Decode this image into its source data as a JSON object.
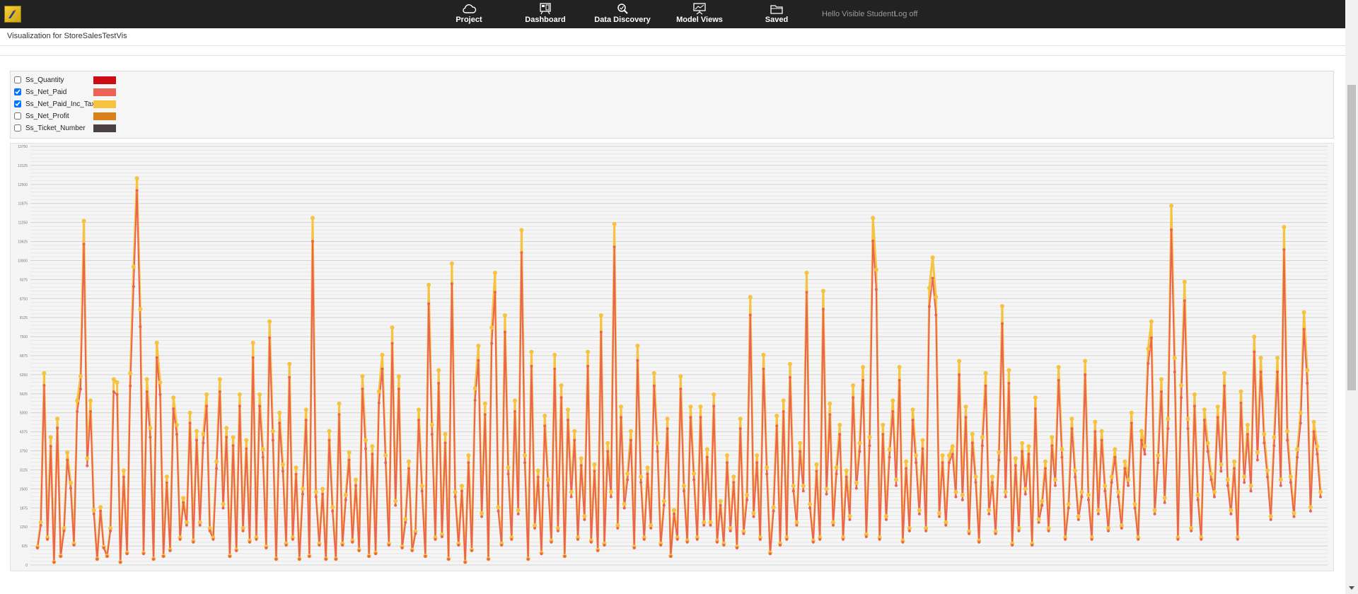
{
  "nav": {
    "items": [
      {
        "label": "Project",
        "icon": "cloud-icon"
      },
      {
        "label": "Dashboard",
        "icon": "dashboard-icon"
      },
      {
        "label": "Data Discovery",
        "icon": "magnifier-icon"
      },
      {
        "label": "Model Views",
        "icon": "presentation-icon"
      },
      {
        "label": "Saved",
        "icon": "folder-icon"
      }
    ],
    "greeting": "Hello Visible Student!",
    "logoff": "Log off"
  },
  "page": {
    "title": "Visualization for StoreSalesTestVis"
  },
  "legend": {
    "items": [
      {
        "label": "Ss_Quantity",
        "checked": false,
        "color": "#cc0b12"
      },
      {
        "label": "Ss_Net_Paid",
        "checked": true,
        "color": "#ea6354"
      },
      {
        "label": "Ss_Net_Paid_Inc_Tax",
        "checked": true,
        "color": "#f6c33e"
      },
      {
        "label": "Ss_Net_Profit",
        "checked": false,
        "color": "#d9801a"
      },
      {
        "label": "Ss_Ticket_Number",
        "checked": false,
        "color": "#4a4146"
      }
    ]
  },
  "chart_data": {
    "type": "line",
    "ylim": [
      0,
      13750
    ],
    "yticks": [
      "0",
      "625",
      "1250",
      "1875",
      "2500",
      "3125",
      "3750",
      "4375",
      "5000",
      "5625",
      "6250",
      "6875",
      "7500",
      "8125",
      "8750",
      "9375",
      "10000",
      "10625",
      "11250",
      "11875",
      "12500",
      "13125",
      "13750"
    ],
    "grid": true,
    "series": [
      {
        "name": "Ss_Net_Paid_Inc_Tax",
        "color": "#f6c33e",
        "values": [
          600,
          1400,
          6300,
          900,
          4200,
          100,
          4800,
          300,
          1200,
          3700,
          2700,
          700,
          5400,
          6200,
          11300,
          3500,
          5400,
          1800,
          200,
          1900,
          600,
          300,
          1200,
          6100,
          6000,
          100,
          3100,
          400,
          6300,
          9800,
          12700,
          8400,
          400,
          6100,
          4500,
          200,
          7300,
          6000,
          300,
          2900,
          500,
          5500,
          4600,
          900,
          2200,
          1400,
          5000,
          800,
          4400,
          1400,
          4300,
          5600,
          1200,
          900,
          3400,
          6100,
          2000,
          4500,
          300,
          4200,
          500,
          5600,
          1200,
          4100,
          800,
          7300,
          900,
          5600,
          3800,
          600,
          8000,
          4400,
          200,
          5000,
          3300,
          700,
          6600,
          900,
          3200,
          200,
          2500,
          5100,
          300,
          11400,
          2400,
          700,
          2500,
          200,
          4400,
          1900,
          200,
          5300,
          700,
          2300,
          3700,
          800,
          2800,
          500,
          6200,
          4100,
          300,
          3900,
          400,
          5700,
          6900,
          3600,
          700,
          7800,
          2100,
          6200,
          600,
          1500,
          3400,
          500,
          1100,
          5100,
          2600,
          300,
          9200,
          4600,
          900,
          6400,
          1000,
          4300,
          200,
          9900,
          2400,
          700,
          2600,
          100,
          3600,
          500,
          5800,
          7200,
          1700,
          5300,
          200,
          7800,
          9600,
          1900,
          700,
          8200,
          3200,
          900,
          5400,
          1800,
          11000,
          3600,
          200,
          7000,
          1300,
          3100,
          400,
          4900,
          2800,
          800,
          6900,
          1200,
          5900,
          300,
          5100,
          2400,
          4400,
          900,
          3500,
          1600,
          7000,
          800,
          3300,
          500,
          8200,
          700,
          4000,
          2400,
          11200,
          1300,
          5200,
          2000,
          3000,
          4400,
          600,
          7200,
          2900,
          900,
          3200,
          1300,
          6300,
          4000,
          700,
          2100,
          4800,
          300,
          1800,
          900,
          6200,
          2600,
          800,
          5200,
          3000,
          900,
          5200,
          1400,
          3800,
          1400,
          5600,
          800,
          2100,
          700,
          3600,
          1200,
          2900,
          600,
          4800,
          1100,
          2300,
          8800,
          1700,
          3600,
          900,
          6900,
          3200,
          400,
          1900,
          4900,
          700,
          5400,
          900,
          6600,
          2600,
          1400,
          4000,
          2600,
          9600,
          2000,
          800,
          3300,
          900,
          9000,
          2500,
          5300,
          1400,
          3200,
          4600,
          900,
          3100,
          1600,
          5900,
          2700,
          4000,
          6500,
          1000,
          4200,
          11400,
          9700,
          900,
          4600,
          1600,
          3800,
          5400,
          2800,
          6500,
          800,
          3400,
          1200,
          5100,
          3600,
          1800,
          4100,
          1200,
          9100,
          10100,
          8800,
          1700,
          3600,
          1400,
          3600,
          3900,
          2400,
          6700,
          2300,
          5200,
          1100,
          4300,
          2900,
          800,
          4200,
          6300,
          1800,
          2900,
          1100,
          3700,
          8500,
          2400,
          6400,
          700,
          3500,
          1200,
          4000,
          2500,
          3900,
          700,
          5500,
          1500,
          2100,
          3400,
          1200,
          4200,
          2800,
          6500,
          3800,
          900,
          2000,
          4800,
          3100,
          1600,
          2400,
          6700,
          2300,
          900,
          4700,
          1800,
          4400,
          2600,
          1200,
          2900,
          3800,
          2400,
          1300,
          3400,
          2800,
          5000,
          2000,
          900,
          4400,
          3900,
          7100,
          8000,
          1800,
          3600,
          6100,
          2200,
          4800,
          11800,
          6800,
          900,
          5900,
          9300,
          4800,
          1200,
          5600,
          2300,
          900,
          5100,
          4000,
          3000,
          2400,
          5200,
          3300,
          6300,
          2800,
          1800,
          3400,
          900,
          5700,
          2900,
          4600,
          2600,
          7500,
          3700,
          6800,
          4300,
          3100,
          1600,
          4200,
          6800,
          2800,
          11100,
          4400,
          2900,
          1700,
          3800,
          5000,
          8300,
          6400,
          1900,
          4700,
          3900,
          2400
        ],
        "markers": true
      },
      {
        "name": "Ss_Net_Paid",
        "color": "#ea6354",
        "values": [
          560,
          1300,
          5900,
          840,
          3900,
          90,
          4500,
          280,
          1120,
          3450,
          2520,
          650,
          5040,
          5780,
          10540,
          3260,
          5040,
          1680,
          190,
          1770,
          560,
          280,
          1120,
          5690,
          5600,
          90,
          2890,
          370,
          5880,
          9150,
          12300,
          7830,
          370,
          5690,
          4200,
          190,
          6810,
          5600,
          280,
          2700,
          470,
          5130,
          4290,
          840,
          2050,
          1310,
          4660,
          750,
          4100,
          1310,
          4010,
          5220,
          1120,
          840,
          3170,
          5690,
          1870,
          4200,
          280,
          3920,
          470,
          5220,
          1120,
          3820,
          750,
          6810,
          840,
          5220,
          3540,
          560,
          7460,
          4100,
          190,
          4660,
          3080,
          650,
          6160,
          840,
          2980,
          190,
          2330,
          4760,
          280,
          10630,
          2240,
          650,
          2330,
          190,
          4100,
          1770,
          190,
          4940,
          650,
          2140,
          3450,
          750,
          2610,
          470,
          5780,
          3820,
          280,
          3640,
          370,
          5320,
          6440,
          3360,
          650,
          7280,
          1960,
          5780,
          560,
          1400,
          3170,
          470,
          1030,
          4760,
          2430,
          280,
          8580,
          4290,
          840,
          5970,
          930,
          4010,
          190,
          9240,
          2240,
          650,
          2430,
          90,
          3360,
          470,
          5410,
          6720,
          1590,
          4940,
          190,
          7280,
          8960,
          1770,
          650,
          7650,
          2990,
          840,
          5040,
          1680,
          10260,
          3360,
          190,
          6530,
          1210,
          2890,
          370,
          4570,
          2610,
          750,
          6440,
          1120,
          5500,
          280,
          4760,
          2240,
          4100,
          840,
          3270,
          1490,
          6530,
          750,
          3080,
          470,
          7650,
          650,
          3730,
          2240,
          10450,
          1210,
          4850,
          1870,
          2800,
          4100,
          560,
          6720,
          2710,
          840,
          2990,
          1210,
          5880,
          3730,
          650,
          1960,
          4480,
          280,
          1680,
          840,
          5780,
          2430,
          750,
          4850,
          2800,
          840,
          4850,
          1310,
          3540,
          1310,
          5220,
          750,
          1960,
          650,
          3360,
          1120,
          2710,
          560,
          4480,
          1030,
          2140,
          8210,
          1590,
          3360,
          840,
          6440,
          2990,
          370,
          1770,
          4570,
          650,
          5040,
          840,
          6160,
          2430,
          1310,
          3730,
          2430,
          8960,
          1870,
          750,
          3080,
          840,
          8400,
          2330,
          4940,
          1310,
          2990,
          4290,
          840,
          2890,
          1490,
          5500,
          2520,
          3730,
          6070,
          930,
          3920,
          10640,
          9050,
          840,
          4290,
          1490,
          3540,
          5040,
          2610,
          6070,
          750,
          3170,
          1120,
          4760,
          3360,
          1680,
          3820,
          1120,
          8490,
          9420,
          8210,
          1590,
          3360,
          1310,
          3360,
          3640,
          2240,
          6250,
          2140,
          4850,
          1030,
          4010,
          2710,
          750,
          3920,
          5880,
          1680,
          2710,
          1030,
          3450,
          7930,
          2240,
          5970,
          650,
          3270,
          1120,
          3730,
          2330,
          3640,
          650,
          5130,
          1400,
          1960,
          3170,
          1120,
          3920,
          2610,
          6070,
          3540,
          840,
          1870,
          4480,
          2890,
          1490,
          2240,
          6250,
          2140,
          840,
          4380,
          1680,
          4100,
          2430,
          1120,
          2710,
          3540,
          2240,
          1210,
          3170,
          2610,
          4660,
          1870,
          840,
          4100,
          3640,
          6620,
          7460,
          1680,
          3360,
          5690,
          2050,
          4480,
          11010,
          6340,
          840,
          5500,
          8680,
          4480,
          1120,
          5220,
          2140,
          840,
          4760,
          3730,
          2800,
          2240,
          4850,
          3080,
          5880,
          2610,
          1680,
          3170,
          840,
          5320,
          2710,
          4290,
          2430,
          7000,
          3450,
          6340,
          4010,
          2890,
          1490,
          3920,
          6340,
          2610,
          10360,
          4100,
          2710,
          1590,
          3540,
          4660,
          7740,
          5970,
          1770,
          4380,
          3640,
          2240
        ],
        "markers": true
      }
    ]
  }
}
